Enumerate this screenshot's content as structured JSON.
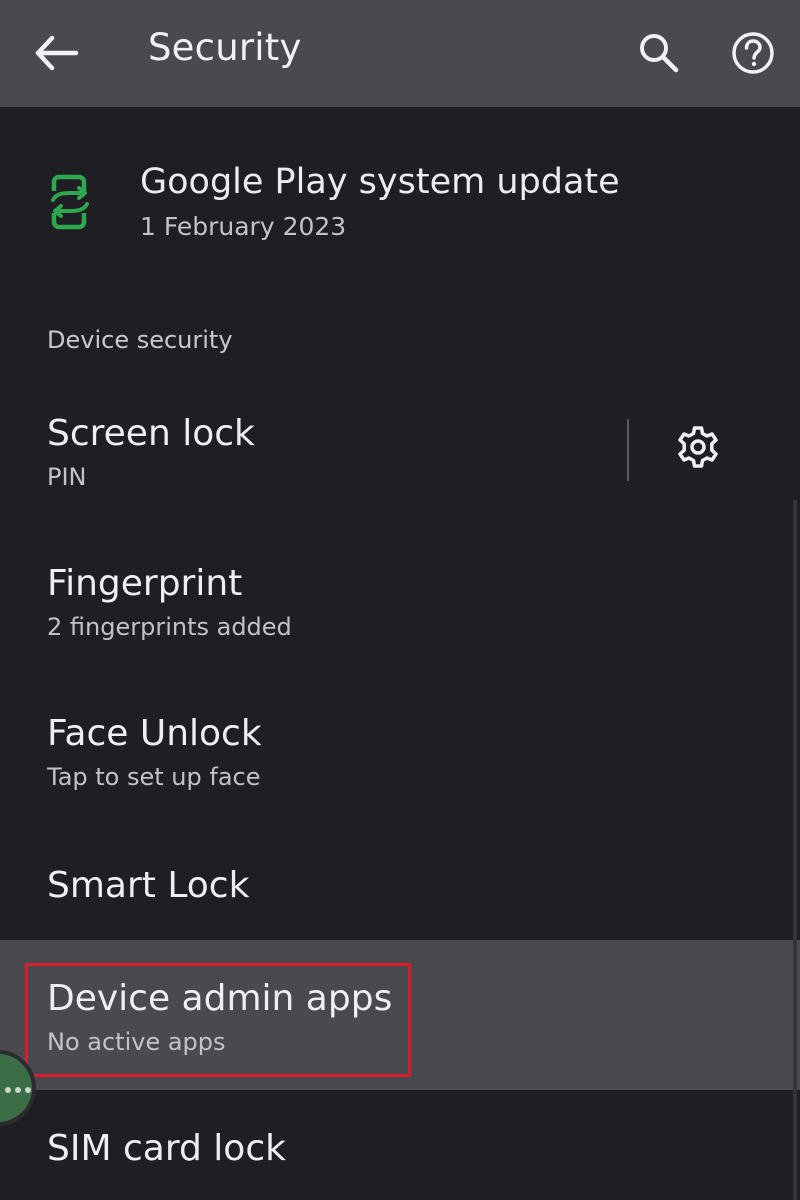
{
  "appbar": {
    "title": "Security",
    "back_icon": "arrow-back-icon",
    "search_icon": "search-icon",
    "help_icon": "help-icon"
  },
  "update": {
    "title": "Google Play system update",
    "subtitle": "1 February 2023",
    "icon": "system-update-icon",
    "icon_color": "#2ea84f"
  },
  "section": {
    "header": "Device security"
  },
  "items": [
    {
      "label": "Screen lock",
      "subtitle": "PIN",
      "action_icon": "gear-icon"
    },
    {
      "label": "Fingerprint",
      "subtitle": "2 fingerprints added"
    },
    {
      "label": "Face Unlock",
      "subtitle": "Tap to set up face"
    },
    {
      "label": "Smart Lock"
    },
    {
      "label": "Device admin apps",
      "subtitle": "No active apps",
      "highlighted": true
    },
    {
      "label": "SIM card lock"
    }
  ],
  "colors": {
    "background": "#1f1e23",
    "appbar": "#4a494f",
    "selected_row": "#4a494f",
    "highlight_border": "#d6202c",
    "fab": "#3b6e46"
  }
}
